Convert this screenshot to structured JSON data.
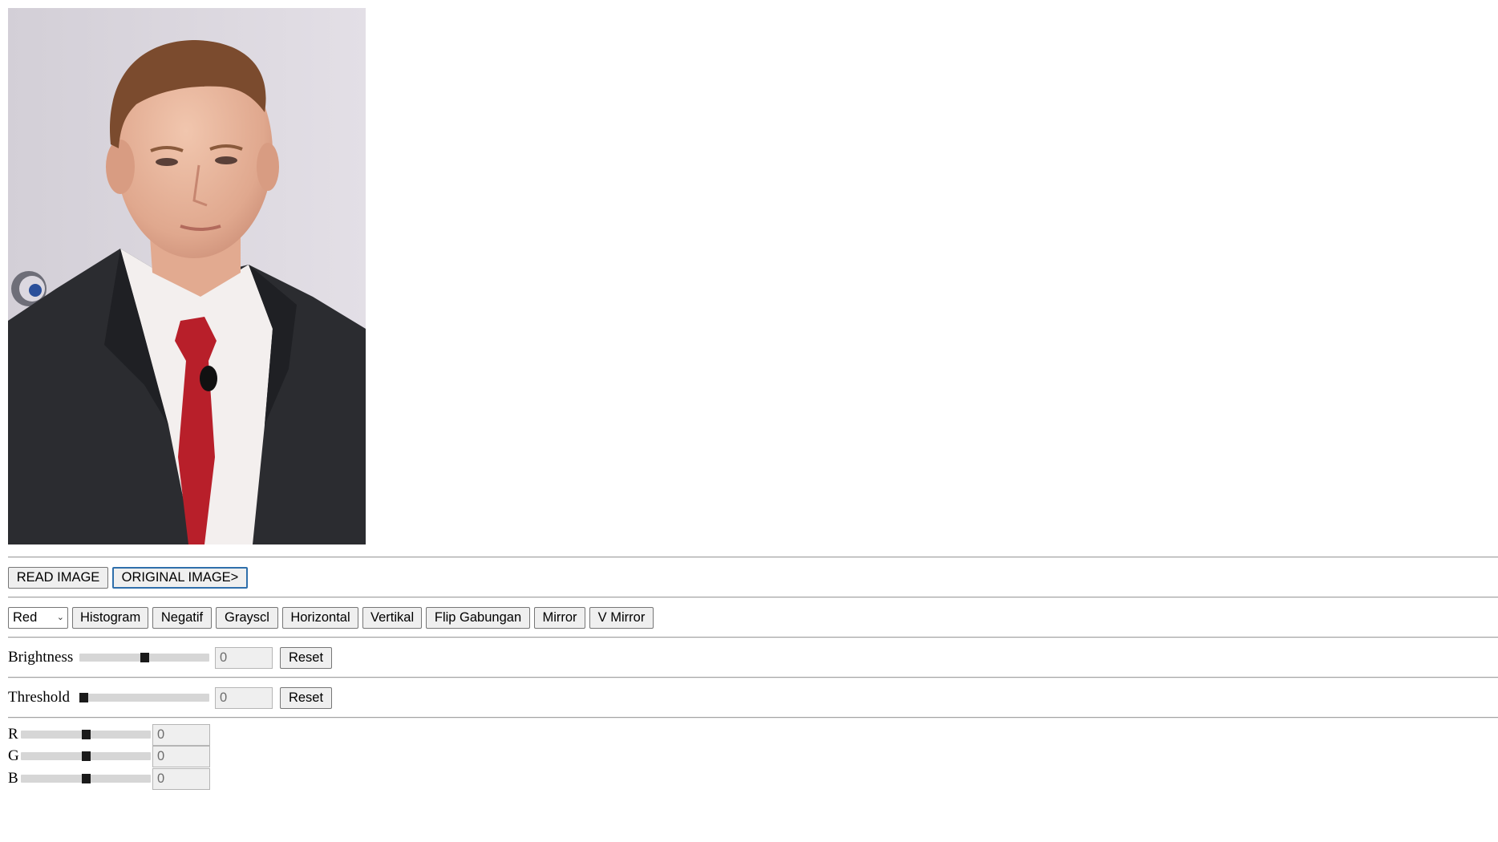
{
  "image": {
    "alt": "photo"
  },
  "file_buttons": {
    "read": "READ IMAGE",
    "original": "ORIGINAL IMAGE>"
  },
  "toolbar": {
    "channel_select": {
      "value": "Red"
    },
    "buttons": [
      "Histogram",
      "Negatif",
      "Grayscl",
      "Horizontal",
      "Vertikal",
      "Flip Gabungan",
      "Mirror",
      "V Mirror"
    ]
  },
  "brightness": {
    "label": "Brightness",
    "value": "0",
    "level": 0.5,
    "reset": "Reset"
  },
  "threshold": {
    "label": "Threshold",
    "value": "0",
    "level": 0.0,
    "reset": "Reset"
  },
  "rgb": [
    {
      "label": "R",
      "value": "0",
      "level": 0.5
    },
    {
      "label": "G",
      "value": "0",
      "level": 0.5
    },
    {
      "label": "B",
      "value": "0",
      "level": 0.5
    }
  ]
}
